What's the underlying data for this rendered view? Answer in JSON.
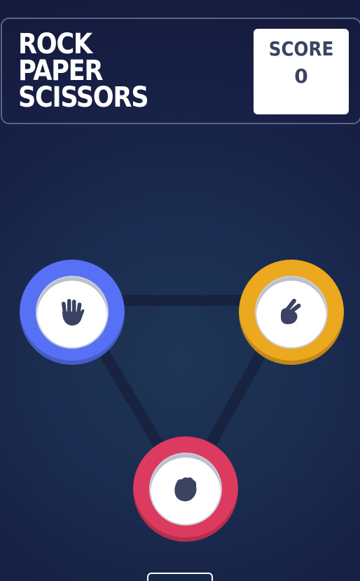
{
  "header": {
    "title_lines": [
      "ROCK",
      "PAPER",
      "SCISSORS"
    ],
    "score_label": "SCORE",
    "score_value": "0"
  },
  "choices": [
    {
      "name": "paper",
      "color": "#5671f5",
      "icon": "hand-paper-icon"
    },
    {
      "name": "scissors",
      "color": "#eca81e",
      "icon": "hand-scissors-icon"
    },
    {
      "name": "rock",
      "color": "#dc3a5e",
      "icon": "hand-rock-icon"
    }
  ],
  "colors": {
    "background": "#1a2c4f",
    "header_border": "#5b6585",
    "score_text": "#3b4363",
    "icon_fill": "#3b4363",
    "triangle": "#16213e"
  },
  "footer": {
    "rules_label": ""
  }
}
